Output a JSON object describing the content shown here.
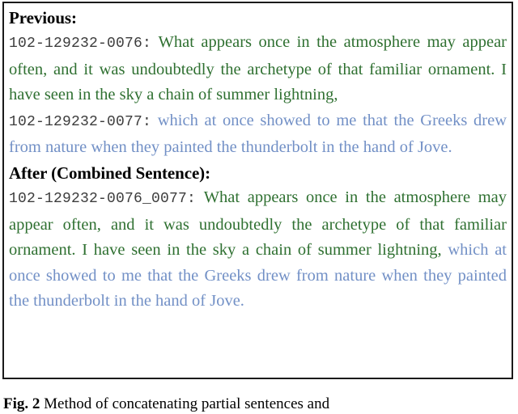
{
  "figure": {
    "caption_label": "Fig. 2",
    "caption_text": "Method of concatenating partial sentences and"
  },
  "box": {
    "border_color": "#1a1a1a",
    "background": "#ffffff"
  },
  "colors": {
    "green": "#2f7031",
    "blue": "#7290c6",
    "id_gray": "#3c3c3c",
    "heading_black": "#000000"
  },
  "sections": [
    {
      "heading": "Previous:",
      "utterances": [
        {
          "id": "102-129232-0076:",
          "color_class": "seg-green",
          "text": "What appears once in the atmosphere may appear often, and it was undoubtedly the archetype of that familiar ornament. I have seen in the sky a chain of summer lightning,"
        },
        {
          "id": "102-129232-0077:",
          "color_class": "seg-blue",
          "text": "which at once showed to me that the Greeks drew from nature when they painted the thunderbolt in the hand of Jove."
        }
      ]
    },
    {
      "heading": "After (Combined Sentence):",
      "utterances": [
        {
          "id": "102-129232-0076_0077:",
          "color_class": "combined",
          "text_green": "What appears once in the atmosphere may appear often, and it was undoubtedly the archetype of that familiar ornament. I have seen in the sky a chain of summer lightning,",
          "text_blue": " which at once showed to me that the Greeks drew from nature when they painted the thunderbolt in the hand of Jove."
        }
      ]
    }
  ]
}
